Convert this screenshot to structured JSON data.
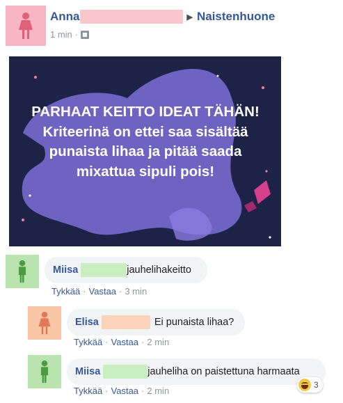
{
  "post": {
    "author": "Anna",
    "group": "Naistenhuone",
    "time": "1 min",
    "image_text": "PARHAAT KEITTO IDEAT TÄHÄN! Kriteerinä on ettei saa sisältää punaista lihaa ja pitää saada mixattua sipuli pois!"
  },
  "comments": [
    {
      "author": "Miisa",
      "text": "jauhelihakeitto",
      "like": "Tykkää",
      "reply": "Vastaa",
      "time": "3 min"
    },
    {
      "author": "Elisa",
      "text": "Ei punaista lihaa?",
      "like": "Tykkää",
      "reply": "Vastaa",
      "time": "2 min"
    },
    {
      "author": "Miisa",
      "text": "jauheliha on paistettuna harmaata",
      "like": "Tykkää",
      "reply": "Vastaa",
      "time": "2 min"
    }
  ],
  "reaction": {
    "type": "haha",
    "count": "3"
  },
  "colors": {
    "link": "#385898",
    "avatar_pink": "#f7b6c2",
    "avatar_green": "#b9e4ae",
    "avatar_peach": "#f9c6a6",
    "bubble": "#f2f3f5",
    "hero_bg": "#1d2346"
  },
  "icons": [
    "person-icon",
    "globe-privacy-icon",
    "caret-right-icon",
    "haha-reaction-icon"
  ]
}
